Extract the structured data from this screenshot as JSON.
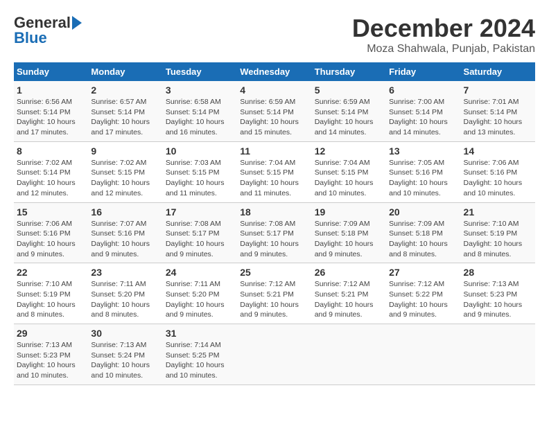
{
  "header": {
    "logo_general": "General",
    "logo_blue": "Blue",
    "month": "December 2024",
    "location": "Moza Shahwala, Punjab, Pakistan"
  },
  "days_of_week": [
    "Sunday",
    "Monday",
    "Tuesday",
    "Wednesday",
    "Thursday",
    "Friday",
    "Saturday"
  ],
  "weeks": [
    [
      {
        "day": "1",
        "sunrise": "Sunrise: 6:56 AM",
        "sunset": "Sunset: 5:14 PM",
        "daylight": "Daylight: 10 hours and 17 minutes."
      },
      {
        "day": "2",
        "sunrise": "Sunrise: 6:57 AM",
        "sunset": "Sunset: 5:14 PM",
        "daylight": "Daylight: 10 hours and 17 minutes."
      },
      {
        "day": "3",
        "sunrise": "Sunrise: 6:58 AM",
        "sunset": "Sunset: 5:14 PM",
        "daylight": "Daylight: 10 hours and 16 minutes."
      },
      {
        "day": "4",
        "sunrise": "Sunrise: 6:59 AM",
        "sunset": "Sunset: 5:14 PM",
        "daylight": "Daylight: 10 hours and 15 minutes."
      },
      {
        "day": "5",
        "sunrise": "Sunrise: 6:59 AM",
        "sunset": "Sunset: 5:14 PM",
        "daylight": "Daylight: 10 hours and 14 minutes."
      },
      {
        "day": "6",
        "sunrise": "Sunrise: 7:00 AM",
        "sunset": "Sunset: 5:14 PM",
        "daylight": "Daylight: 10 hours and 14 minutes."
      },
      {
        "day": "7",
        "sunrise": "Sunrise: 7:01 AM",
        "sunset": "Sunset: 5:14 PM",
        "daylight": "Daylight: 10 hours and 13 minutes."
      }
    ],
    [
      {
        "day": "8",
        "sunrise": "Sunrise: 7:02 AM",
        "sunset": "Sunset: 5:14 PM",
        "daylight": "Daylight: 10 hours and 12 minutes."
      },
      {
        "day": "9",
        "sunrise": "Sunrise: 7:02 AM",
        "sunset": "Sunset: 5:15 PM",
        "daylight": "Daylight: 10 hours and 12 minutes."
      },
      {
        "day": "10",
        "sunrise": "Sunrise: 7:03 AM",
        "sunset": "Sunset: 5:15 PM",
        "daylight": "Daylight: 10 hours and 11 minutes."
      },
      {
        "day": "11",
        "sunrise": "Sunrise: 7:04 AM",
        "sunset": "Sunset: 5:15 PM",
        "daylight": "Daylight: 10 hours and 11 minutes."
      },
      {
        "day": "12",
        "sunrise": "Sunrise: 7:04 AM",
        "sunset": "Sunset: 5:15 PM",
        "daylight": "Daylight: 10 hours and 10 minutes."
      },
      {
        "day": "13",
        "sunrise": "Sunrise: 7:05 AM",
        "sunset": "Sunset: 5:16 PM",
        "daylight": "Daylight: 10 hours and 10 minutes."
      },
      {
        "day": "14",
        "sunrise": "Sunrise: 7:06 AM",
        "sunset": "Sunset: 5:16 PM",
        "daylight": "Daylight: 10 hours and 10 minutes."
      }
    ],
    [
      {
        "day": "15",
        "sunrise": "Sunrise: 7:06 AM",
        "sunset": "Sunset: 5:16 PM",
        "daylight": "Daylight: 10 hours and 9 minutes."
      },
      {
        "day": "16",
        "sunrise": "Sunrise: 7:07 AM",
        "sunset": "Sunset: 5:16 PM",
        "daylight": "Daylight: 10 hours and 9 minutes."
      },
      {
        "day": "17",
        "sunrise": "Sunrise: 7:08 AM",
        "sunset": "Sunset: 5:17 PM",
        "daylight": "Daylight: 10 hours and 9 minutes."
      },
      {
        "day": "18",
        "sunrise": "Sunrise: 7:08 AM",
        "sunset": "Sunset: 5:17 PM",
        "daylight": "Daylight: 10 hours and 9 minutes."
      },
      {
        "day": "19",
        "sunrise": "Sunrise: 7:09 AM",
        "sunset": "Sunset: 5:18 PM",
        "daylight": "Daylight: 10 hours and 9 minutes."
      },
      {
        "day": "20",
        "sunrise": "Sunrise: 7:09 AM",
        "sunset": "Sunset: 5:18 PM",
        "daylight": "Daylight: 10 hours and 8 minutes."
      },
      {
        "day": "21",
        "sunrise": "Sunrise: 7:10 AM",
        "sunset": "Sunset: 5:19 PM",
        "daylight": "Daylight: 10 hours and 8 minutes."
      }
    ],
    [
      {
        "day": "22",
        "sunrise": "Sunrise: 7:10 AM",
        "sunset": "Sunset: 5:19 PM",
        "daylight": "Daylight: 10 hours and 8 minutes."
      },
      {
        "day": "23",
        "sunrise": "Sunrise: 7:11 AM",
        "sunset": "Sunset: 5:20 PM",
        "daylight": "Daylight: 10 hours and 8 minutes."
      },
      {
        "day": "24",
        "sunrise": "Sunrise: 7:11 AM",
        "sunset": "Sunset: 5:20 PM",
        "daylight": "Daylight: 10 hours and 9 minutes."
      },
      {
        "day": "25",
        "sunrise": "Sunrise: 7:12 AM",
        "sunset": "Sunset: 5:21 PM",
        "daylight": "Daylight: 10 hours and 9 minutes."
      },
      {
        "day": "26",
        "sunrise": "Sunrise: 7:12 AM",
        "sunset": "Sunset: 5:21 PM",
        "daylight": "Daylight: 10 hours and 9 minutes."
      },
      {
        "day": "27",
        "sunrise": "Sunrise: 7:12 AM",
        "sunset": "Sunset: 5:22 PM",
        "daylight": "Daylight: 10 hours and 9 minutes."
      },
      {
        "day": "28",
        "sunrise": "Sunrise: 7:13 AM",
        "sunset": "Sunset: 5:23 PM",
        "daylight": "Daylight: 10 hours and 9 minutes."
      }
    ],
    [
      {
        "day": "29",
        "sunrise": "Sunrise: 7:13 AM",
        "sunset": "Sunset: 5:23 PM",
        "daylight": "Daylight: 10 hours and 10 minutes."
      },
      {
        "day": "30",
        "sunrise": "Sunrise: 7:13 AM",
        "sunset": "Sunset: 5:24 PM",
        "daylight": "Daylight: 10 hours and 10 minutes."
      },
      {
        "day": "31",
        "sunrise": "Sunrise: 7:14 AM",
        "sunset": "Sunset: 5:25 PM",
        "daylight": "Daylight: 10 hours and 10 minutes."
      },
      null,
      null,
      null,
      null
    ]
  ]
}
